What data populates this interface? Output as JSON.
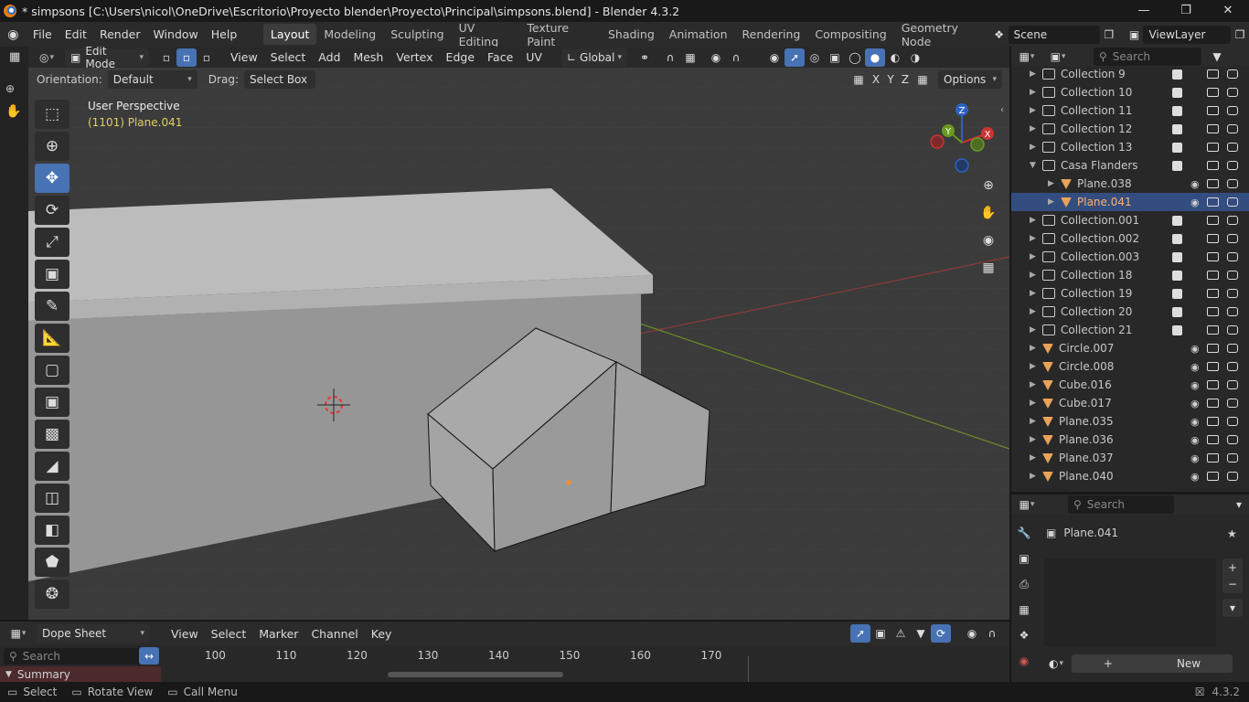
{
  "window": {
    "title": "* simpsons [C:\\Users\\nicol\\OneDrive\\Escritorio\\Proyecto blender\\Proyecto\\Principal\\simpsons.blend] - Blender 4.3.2"
  },
  "menu": [
    "File",
    "Edit",
    "Render",
    "Window",
    "Help"
  ],
  "workspaces": [
    "Layout",
    "Modeling",
    "Sculpting",
    "UV Editing",
    "Texture Paint",
    "Shading",
    "Animation",
    "Rendering",
    "Compositing",
    "Geometry Node"
  ],
  "scene": "Scene",
  "view_layer": "ViewLayer",
  "search_placeholder": "Search",
  "viewport": {
    "mode": "Edit Mode",
    "menus": [
      "View",
      "Select",
      "Add",
      "Mesh",
      "Vertex",
      "Edge",
      "Face",
      "UV"
    ],
    "transform": "Global",
    "orientation_label": "Orientation:",
    "orientation": "Default",
    "drag_label": "Drag:",
    "drag": "Select Box",
    "axes": [
      "X",
      "Y",
      "Z"
    ],
    "options": "Options",
    "perspective": "User Perspective",
    "object_info": "(1101) Plane.041",
    "gizmo": {
      "x": "X",
      "y": "Y",
      "z": "Z"
    }
  },
  "outliner": {
    "rows": [
      {
        "name": "Collection 9",
        "type": "collection",
        "depth": 1
      },
      {
        "name": "Collection 10",
        "type": "collection",
        "depth": 1
      },
      {
        "name": "Collection 11",
        "type": "collection",
        "depth": 1
      },
      {
        "name": "Collection 12",
        "type": "collection",
        "depth": 1
      },
      {
        "name": "Collection 13",
        "type": "collection",
        "depth": 1
      },
      {
        "name": "Casa Flanders",
        "type": "collection",
        "depth": 1,
        "expanded": true
      },
      {
        "name": "Plane.038",
        "type": "object",
        "depth": 2
      },
      {
        "name": "Plane.041",
        "type": "object",
        "depth": 2,
        "selected": true
      },
      {
        "name": "Collection.001",
        "type": "collection",
        "depth": 1
      },
      {
        "name": "Collection.002",
        "type": "collection",
        "depth": 1
      },
      {
        "name": "Collection.003",
        "type": "collection",
        "depth": 1
      },
      {
        "name": "Collection 18",
        "type": "collection",
        "depth": 1
      },
      {
        "name": "Collection 19",
        "type": "collection",
        "depth": 1
      },
      {
        "name": "Collection 20",
        "type": "collection",
        "depth": 1
      },
      {
        "name": "Collection 21",
        "type": "collection",
        "depth": 1
      },
      {
        "name": "Circle.007",
        "type": "object",
        "depth": 1
      },
      {
        "name": "Circle.008",
        "type": "object",
        "depth": 1
      },
      {
        "name": "Cube.016",
        "type": "object",
        "depth": 1
      },
      {
        "name": "Cube.017",
        "type": "object",
        "depth": 1
      },
      {
        "name": "Plane.035",
        "type": "object",
        "depth": 1
      },
      {
        "name": "Plane.036",
        "type": "object",
        "depth": 1
      },
      {
        "name": "Plane.037",
        "type": "object",
        "depth": 1
      },
      {
        "name": "Plane.040",
        "type": "object",
        "depth": 1
      }
    ]
  },
  "properties": {
    "object": "Plane.041",
    "new_label": "New",
    "plus": "+",
    "minus": "−"
  },
  "dopesheet": {
    "editor": "Dope Sheet",
    "menus": [
      "View",
      "Select",
      "Marker",
      "Channel",
      "Key"
    ],
    "frames": [
      "100",
      "110",
      "120",
      "130",
      "140",
      "150",
      "160",
      "170"
    ],
    "summary": "Summary"
  },
  "status": {
    "items": [
      "Select",
      "Rotate View",
      "Call Menu"
    ],
    "version": "4.3.2"
  }
}
